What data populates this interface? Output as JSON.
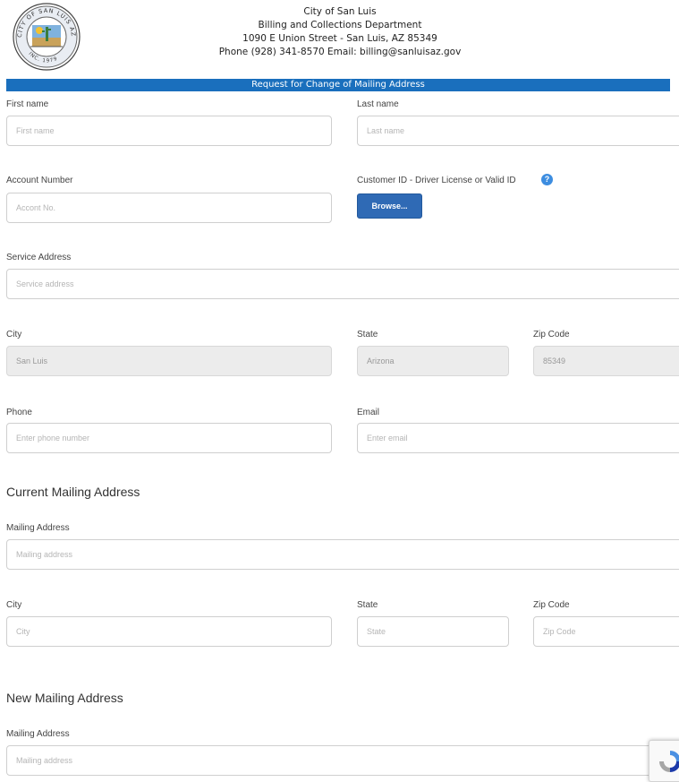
{
  "header": {
    "line1": "City of San Luis",
    "line2": "Billing and Collections Department",
    "line3": "1090 E Union Street - San Luis, AZ 85349",
    "line4": "Phone (928) 341-8570 Email: billing@sanluisaz.gov",
    "seal_text_top": "CITY OF SAN LUIS AZ",
    "seal_text_bottom": "INC. 1979"
  },
  "title_bar": "Request for Change of Mailing Address",
  "form": {
    "first_name": {
      "label": "First name",
      "placeholder": "First name"
    },
    "last_name": {
      "label": "Last name",
      "placeholder": "Last name"
    },
    "account_number": {
      "label": "Account Number",
      "placeholder": "Accont No."
    },
    "customer_id": {
      "label": "Customer ID - Driver License or Valid ID",
      "button": "Browse...",
      "help_icon": "question-icon"
    },
    "service_address": {
      "label": "Service Address",
      "placeholder": "Service address"
    },
    "service_city": {
      "label": "City",
      "value": "San Luis"
    },
    "service_state": {
      "label": "State",
      "value": "Arizona"
    },
    "service_zip": {
      "label": "Zip Code",
      "value": "85349"
    },
    "phone": {
      "label": "Phone",
      "placeholder": "Enter phone number"
    },
    "email": {
      "label": "Email",
      "placeholder": "Enter email"
    }
  },
  "current_mailing": {
    "heading": "Current Mailing Address",
    "address": {
      "label": "Mailing Address",
      "placeholder": "Mailing address"
    },
    "city": {
      "label": "City",
      "placeholder": "City"
    },
    "state": {
      "label": "State",
      "placeholder": "State"
    },
    "zip": {
      "label": "Zip Code",
      "placeholder": "Zip Code"
    }
  },
  "new_mailing": {
    "heading": "New Mailing Address",
    "address": {
      "label": "Mailing Address",
      "placeholder": "Mailing address"
    }
  },
  "colors": {
    "title_bar": "#1a6fbd",
    "browse_button": "#2f6ab5",
    "help_icon": "#3d8de0"
  }
}
